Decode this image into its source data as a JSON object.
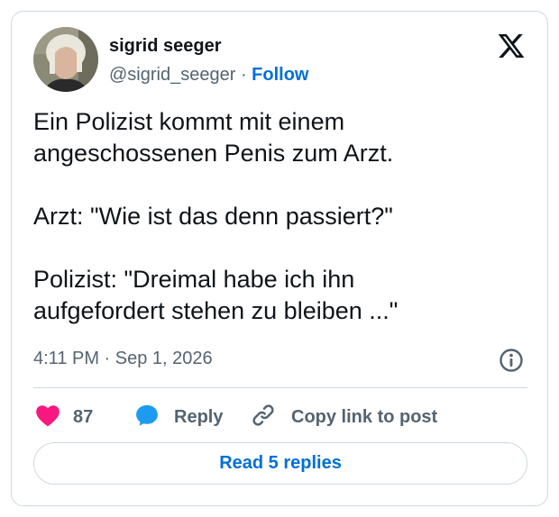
{
  "author": {
    "name": "sigrid seeger",
    "handle": "@sigrid_seeger",
    "separator": "·",
    "follow_label": "Follow"
  },
  "tweet": {
    "text": "Ein Polizist kommt mit einem\nangeschossenen Penis zum Arzt.\n\nArzt: \"Wie ist das denn passiert?\"\n\nPolizist: \"Dreimal habe ich ihn\naufgefordert stehen zu bleiben ...\"",
    "timestamp": "4:11 PM · Sep 1, 2026"
  },
  "actions": {
    "like_count": "87",
    "reply_label": "Reply",
    "copy_label": "Copy link to post",
    "read_replies_label": "Read 5 replies"
  },
  "icons": [
    "x-logo-icon",
    "info-icon",
    "heart-icon",
    "reply-bubble-icon",
    "link-icon"
  ],
  "colors": {
    "text": "#0f1419",
    "secondary": "#536471",
    "link": "#006fd6",
    "like": "#f91880",
    "reply": "#1d9bf0",
    "border": "#cfd9de"
  }
}
